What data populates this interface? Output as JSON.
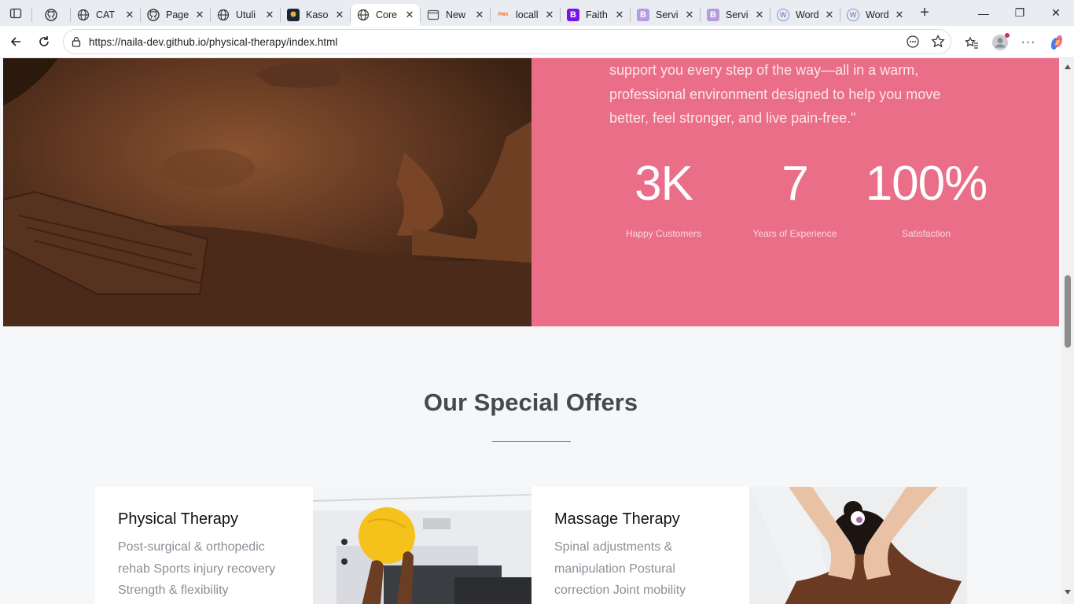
{
  "browser": {
    "tabs": [
      {
        "label": "",
        "icon": "github-icon",
        "icon_text": ""
      },
      {
        "label": "CAT",
        "icon": "globe-icon",
        "icon_text": ""
      },
      {
        "label": "Page",
        "icon": "github-icon",
        "icon_text": ""
      },
      {
        "label": "Utuli",
        "icon": "globe-icon",
        "icon_text": ""
      },
      {
        "label": "Kaso",
        "icon": "kaso-icon",
        "icon_text": ""
      },
      {
        "label": "Core",
        "icon": "globe-icon",
        "icon_text": "",
        "active": true
      },
      {
        "label": "New",
        "icon": "page-icon",
        "icon_text": ""
      },
      {
        "label": "locall",
        "icon": "pma-icon",
        "icon_text": "PMA"
      },
      {
        "label": "Faith",
        "icon": "bootstrap-icon",
        "icon_text": "B"
      },
      {
        "label": "Servi",
        "icon": "bootstrap-light-icon",
        "icon_text": "B"
      },
      {
        "label": "Servi",
        "icon": "bootstrap-light-icon",
        "icon_text": "B"
      },
      {
        "label": "Word",
        "icon": "wordpress-icon",
        "icon_text": "W"
      },
      {
        "label": "Word",
        "icon": "wordpress-icon",
        "icon_text": "W"
      }
    ],
    "url": "https://naila-dev.github.io/physical-therapy/index.html"
  },
  "hero": {
    "quote": "support you every step of the way—all in a warm, professional environment designed to help you move better, feel stronger, and live pain-free.\"",
    "stats": [
      {
        "value": "3K",
        "label": "Happy Customers"
      },
      {
        "value": "7",
        "label": "Years of Experience"
      },
      {
        "value": "100%",
        "label": "Satisfaction"
      }
    ],
    "accent_color": "#ea6e88"
  },
  "offers": {
    "title": "Our Special Offers",
    "cards": [
      {
        "title": "Physical Therapy",
        "text": "Post-surgical & orthopedic rehab Sports injury recovery Strength & flexibility"
      },
      {
        "title": "Massage Therapy",
        "text": "Spinal adjustments & manipulation Postural correction Joint mobility"
      }
    ]
  }
}
